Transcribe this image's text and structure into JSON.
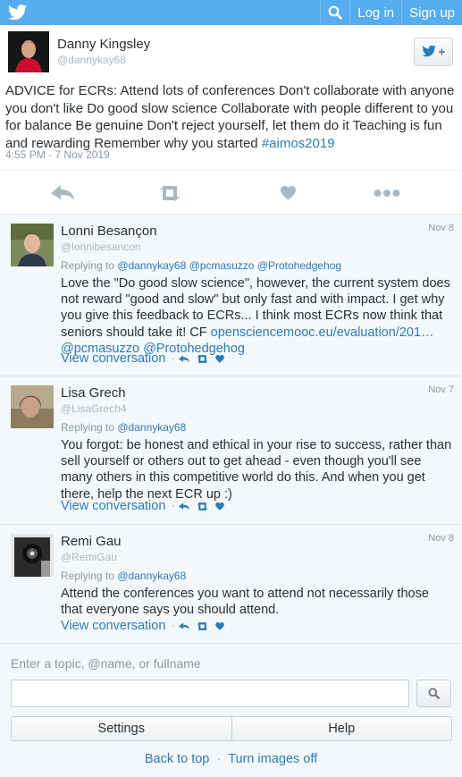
{
  "topbar": {
    "logo_icon": "twitter-bird-icon",
    "search_icon": "search-icon",
    "login_label": "Log in",
    "signup_label": "Sign up"
  },
  "tweet": {
    "author_name": "Danny Kingsley",
    "author_handle": "@dannykay68",
    "follow_icon": "follow-bird-plus-icon",
    "text": "ADVICE for ECRs: Attend lots of conferences Don't collaborate with anyone you don't like Do good slow science Collaborate with people different to you for balance Be genuine Don't reject yourself, let them do it Teaching is fun and rewarding Remember why you started ",
    "hashtag": "#aimos2019",
    "timestamp": "4:55 PM - 7 Nov 2019",
    "actions": [
      "reply-icon",
      "retweet-icon",
      "like-icon",
      "more-icon"
    ]
  },
  "replies": [
    {
      "name": "Lonni Besançon",
      "handle": "@lonnibesancon",
      "date": "Nov 8",
      "replying_prefix": "Replying to ",
      "mentions": "@dannykay68 @pcmasuzzo @Protohedgehog",
      "text": "Love the \"Do good slow science\", however, the current system does not reward \"good and slow\" but only fast and with impact. I get why you give this feedback to ECRs... I think most ECRs now think that seniors should take it! CF ",
      "link": "opensciencemooc.eu/evaluation/201…",
      "trailing": "@pcmasuzzo @Protohedgehog",
      "view_label": "View conversation"
    },
    {
      "name": "Lisa Grech",
      "handle": "@LisaGrech4",
      "date": "Nov 7",
      "replying_prefix": "Replying to ",
      "mentions": "@dannykay68",
      "text": "You forgot: be honest and ethical in your rise to success, rather than sell yourself or others out to get ahead - even though you'll see many others in this competitive world do this. And when you get there, help the next ECR up :)",
      "view_label": "View conversation"
    },
    {
      "name": "Remi Gau",
      "handle": "@RemiGau",
      "date": "Nov 8",
      "replying_prefix": "Replying to ",
      "mentions": "@dannykay68",
      "text": "Attend the conferences you want to attend not necessarily those that everyone says you should attend.",
      "view_label": "View conversation"
    }
  ],
  "search": {
    "label": "Enter a topic, @name, or fullname",
    "value": "",
    "button_icon": "search-icon"
  },
  "footer": {
    "settings_label": "Settings",
    "help_label": "Help",
    "back_to_top": "Back to top",
    "separator": "·",
    "images_off": "Turn images off"
  },
  "colors": {
    "brand": "#55acee",
    "link": "#2b7bb9",
    "muted": "#8899a6",
    "reply_bg": "#f5f8fa"
  }
}
